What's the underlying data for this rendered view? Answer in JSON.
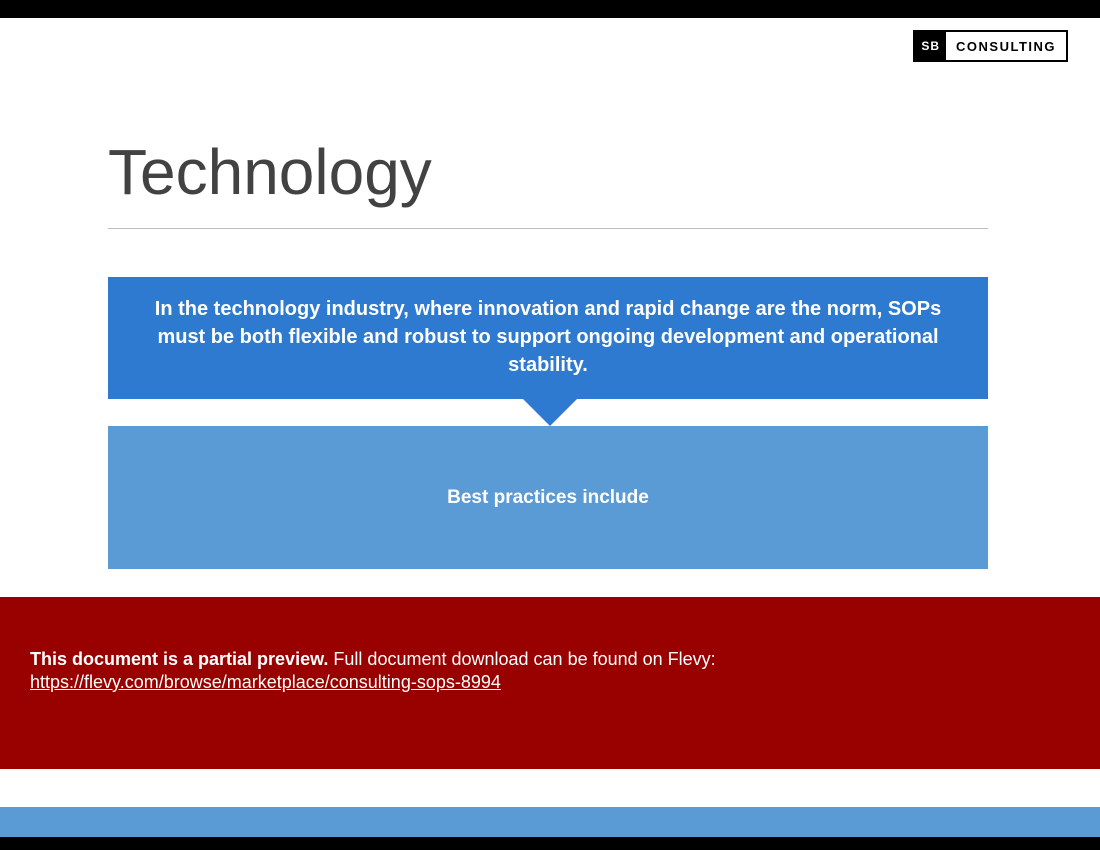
{
  "logo": {
    "badge": "SB",
    "text": "CONSULTING"
  },
  "title": "Technology",
  "intro": "In the technology industry, where innovation and rapid change are the norm, SOPs must be both flexible and robust to support ongoing development and operational stability.",
  "practices_label": "Best practices include",
  "preview": {
    "bold": "This document is a partial preview.",
    "rest": "  Full document download can be found on Flevy:",
    "link": "https://flevy.com/browse/marketplace/consulting-sops-8994"
  }
}
